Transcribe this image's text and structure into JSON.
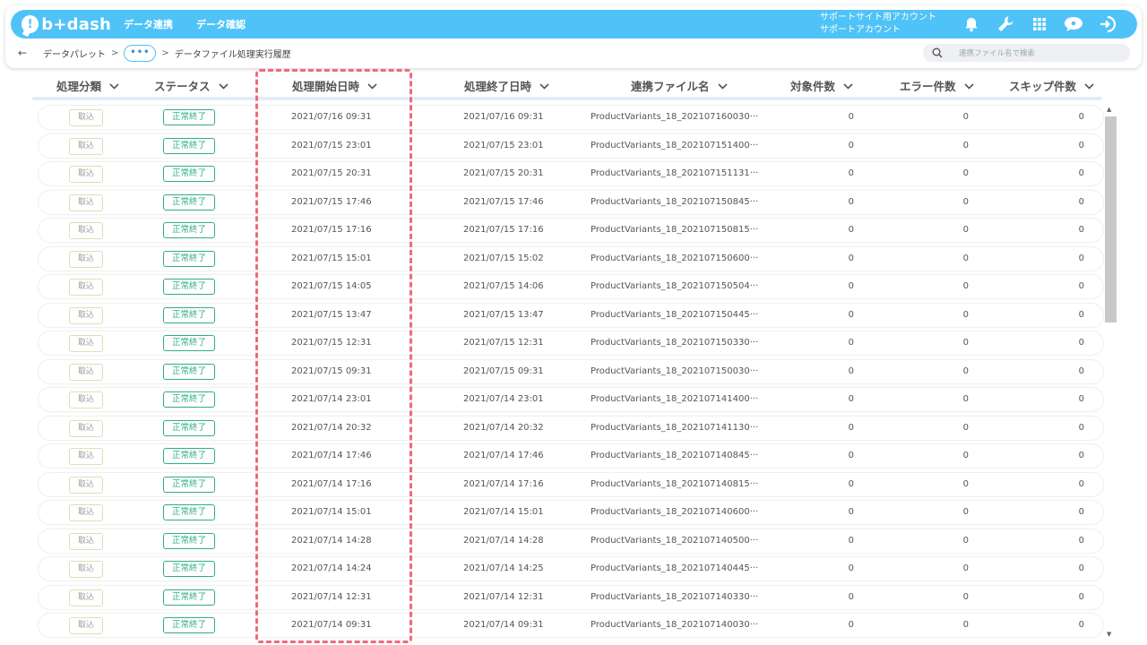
{
  "app": {
    "logo_mark": "!",
    "logo_text": "b+dash",
    "nav": [
      "データ連携",
      "データ確認"
    ],
    "account_line1": "サポートサイト用アカウント",
    "account_line2": "サポートアカウント",
    "icons": [
      "bell-icon",
      "wrench-icon",
      "grid-icon",
      "cloud-chat-icon",
      "logout-icon"
    ],
    "accent_color": "#4fc3f7"
  },
  "breadcrumb": {
    "back_icon": "←",
    "item1": "データパレット",
    "sep": ">",
    "more": "•••",
    "current": "データファイル処理実行履歴"
  },
  "search": {
    "placeholder": "連携ファイル名で検索",
    "icon": "search-icon"
  },
  "columns": [
    "処理分類",
    "ステータス",
    "処理開始日時",
    "処理終了日時",
    "連携ファイル名",
    "対象件数",
    "エラー件数",
    "スキップ件数"
  ],
  "rows": [
    {
      "type": "取込",
      "status": "正常終了",
      "start": "2021/07/16 09:31",
      "end": "2021/07/16 09:31",
      "file": "ProductVariants_18_202107160030···",
      "target": "0",
      "error": "0",
      "skip": "0"
    },
    {
      "type": "取込",
      "status": "正常終了",
      "start": "2021/07/15 23:01",
      "end": "2021/07/15 23:01",
      "file": "ProductVariants_18_202107151400···",
      "target": "0",
      "error": "0",
      "skip": "0"
    },
    {
      "type": "取込",
      "status": "正常終了",
      "start": "2021/07/15 20:31",
      "end": "2021/07/15 20:31",
      "file": "ProductVariants_18_202107151131···",
      "target": "0",
      "error": "0",
      "skip": "0"
    },
    {
      "type": "取込",
      "status": "正常終了",
      "start": "2021/07/15 17:46",
      "end": "2021/07/15 17:46",
      "file": "ProductVariants_18_202107150845···",
      "target": "0",
      "error": "0",
      "skip": "0"
    },
    {
      "type": "取込",
      "status": "正常終了",
      "start": "2021/07/15 17:16",
      "end": "2021/07/15 17:16",
      "file": "ProductVariants_18_202107150815···",
      "target": "0",
      "error": "0",
      "skip": "0"
    },
    {
      "type": "取込",
      "status": "正常終了",
      "start": "2021/07/15 15:01",
      "end": "2021/07/15 15:02",
      "file": "ProductVariants_18_202107150600···",
      "target": "0",
      "error": "0",
      "skip": "0"
    },
    {
      "type": "取込",
      "status": "正常終了",
      "start": "2021/07/15 14:05",
      "end": "2021/07/15 14:06",
      "file": "ProductVariants_18_202107150504···",
      "target": "0",
      "error": "0",
      "skip": "0"
    },
    {
      "type": "取込",
      "status": "正常終了",
      "start": "2021/07/15 13:47",
      "end": "2021/07/15 13:47",
      "file": "ProductVariants_18_202107150445···",
      "target": "0",
      "error": "0",
      "skip": "0"
    },
    {
      "type": "取込",
      "status": "正常終了",
      "start": "2021/07/15 12:31",
      "end": "2021/07/15 12:31",
      "file": "ProductVariants_18_202107150330···",
      "target": "0",
      "error": "0",
      "skip": "0"
    },
    {
      "type": "取込",
      "status": "正常終了",
      "start": "2021/07/15 09:31",
      "end": "2021/07/15 09:31",
      "file": "ProductVariants_18_202107150030···",
      "target": "0",
      "error": "0",
      "skip": "0"
    },
    {
      "type": "取込",
      "status": "正常終了",
      "start": "2021/07/14 23:01",
      "end": "2021/07/14 23:01",
      "file": "ProductVariants_18_202107141400···",
      "target": "0",
      "error": "0",
      "skip": "0"
    },
    {
      "type": "取込",
      "status": "正常終了",
      "start": "2021/07/14 20:32",
      "end": "2021/07/14 20:32",
      "file": "ProductVariants_18_202107141130···",
      "target": "0",
      "error": "0",
      "skip": "0"
    },
    {
      "type": "取込",
      "status": "正常終了",
      "start": "2021/07/14 17:46",
      "end": "2021/07/14 17:46",
      "file": "ProductVariants_18_202107140845···",
      "target": "0",
      "error": "0",
      "skip": "0"
    },
    {
      "type": "取込",
      "status": "正常終了",
      "start": "2021/07/14 17:16",
      "end": "2021/07/14 17:16",
      "file": "ProductVariants_18_202107140815···",
      "target": "0",
      "error": "0",
      "skip": "0"
    },
    {
      "type": "取込",
      "status": "正常終了",
      "start": "2021/07/14 15:01",
      "end": "2021/07/14 15:01",
      "file": "ProductVariants_18_202107140600···",
      "target": "0",
      "error": "0",
      "skip": "0"
    },
    {
      "type": "取込",
      "status": "正常終了",
      "start": "2021/07/14 14:28",
      "end": "2021/07/14 14:28",
      "file": "ProductVariants_18_202107140500···",
      "target": "0",
      "error": "0",
      "skip": "0"
    },
    {
      "type": "取込",
      "status": "正常終了",
      "start": "2021/07/14 14:24",
      "end": "2021/07/14 14:25",
      "file": "ProductVariants_18_202107140445···",
      "target": "0",
      "error": "0",
      "skip": "0"
    },
    {
      "type": "取込",
      "status": "正常終了",
      "start": "2021/07/14 12:31",
      "end": "2021/07/14 12:31",
      "file": "ProductVariants_18_202107140330···",
      "target": "0",
      "error": "0",
      "skip": "0"
    },
    {
      "type": "取込",
      "status": "正常終了",
      "start": "2021/07/14 09:31",
      "end": "2021/07/14 09:31",
      "file": "ProductVariants_18_202107140030···",
      "target": "0",
      "error": "0",
      "skip": "0"
    }
  ],
  "status_color": "#2fae82",
  "highlight_color": "#ef6a7a"
}
